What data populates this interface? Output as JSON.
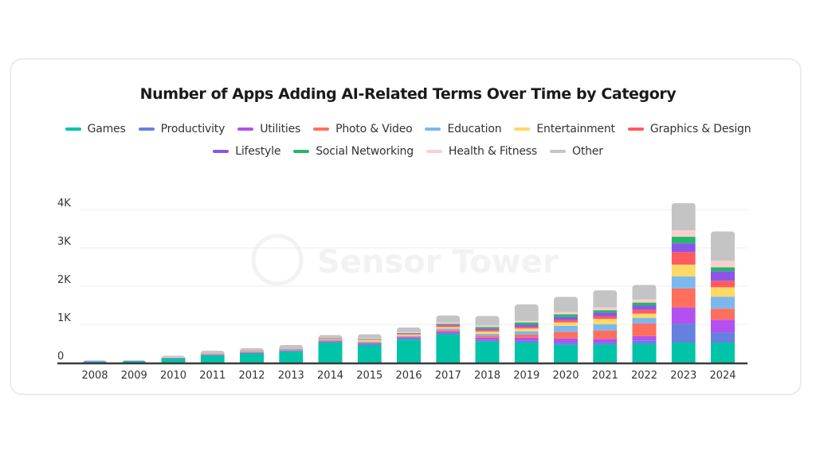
{
  "chart_data": {
    "type": "bar",
    "stacked": true,
    "title": "Number of Apps Adding AI-Related Terms Over Time by Category",
    "xlabel": "",
    "ylabel": "",
    "ylim": [
      0,
      4200
    ],
    "yticks": [
      0,
      1000,
      2000,
      3000,
      4000
    ],
    "ytick_labels": [
      "0",
      "1K",
      "2K",
      "3K",
      "4K"
    ],
    "grid": true,
    "legend_position": "top-center",
    "watermark": "Sensor Tower",
    "categories": [
      "2008",
      "2009",
      "2010",
      "2011",
      "2012",
      "2013",
      "2014",
      "2015",
      "2016",
      "2017",
      "2018",
      "2019",
      "2020",
      "2021",
      "2022",
      "2023",
      "2024"
    ],
    "series": [
      {
        "name": "Games",
        "color": "#00c4a7",
        "values": [
          20,
          40,
          110,
          190,
          240,
          290,
          520,
          460,
          600,
          740,
          550,
          520,
          460,
          470,
          480,
          520,
          520
        ]
      },
      {
        "name": "Productivity",
        "color": "#6680e0",
        "values": [
          10,
          5,
          5,
          10,
          10,
          15,
          20,
          20,
          25,
          30,
          40,
          50,
          60,
          50,
          100,
          500,
          270
        ]
      },
      {
        "name": "Utilities",
        "color": "#b450f0",
        "values": [
          5,
          5,
          5,
          10,
          10,
          15,
          20,
          20,
          30,
          40,
          60,
          80,
          110,
          100,
          110,
          420,
          330
        ]
      },
      {
        "name": "Photo & Video",
        "color": "#ff6f5c",
        "values": [
          0,
          0,
          5,
          10,
          10,
          10,
          20,
          20,
          20,
          40,
          50,
          80,
          170,
          220,
          330,
          500,
          290
        ]
      },
      {
        "name": "Education",
        "color": "#7cb8ee",
        "values": [
          20,
          5,
          5,
          10,
          10,
          10,
          20,
          30,
          30,
          40,
          50,
          90,
          160,
          160,
          150,
          310,
          310
        ]
      },
      {
        "name": "Entertainment",
        "color": "#ffd966",
        "values": [
          0,
          0,
          5,
          5,
          20,
          10,
          15,
          40,
          30,
          40,
          60,
          70,
          90,
          140,
          110,
          310,
          250
        ]
      },
      {
        "name": "Graphics & Design",
        "color": "#ff5a5f",
        "values": [
          0,
          0,
          0,
          5,
          5,
          5,
          10,
          10,
          15,
          40,
          40,
          40,
          60,
          70,
          100,
          330,
          170
        ]
      },
      {
        "name": "Lifestyle",
        "color": "#8a55e8",
        "values": [
          0,
          0,
          0,
          0,
          5,
          5,
          10,
          10,
          15,
          25,
          40,
          60,
          80,
          100,
          110,
          230,
          250
        ]
      },
      {
        "name": "Social Networking",
        "color": "#22b86a",
        "values": [
          0,
          0,
          0,
          0,
          0,
          5,
          5,
          10,
          10,
          20,
          40,
          60,
          70,
          60,
          80,
          170,
          100
        ]
      },
      {
        "name": "Health & Fitness",
        "color": "#fbd0cc",
        "values": [
          0,
          0,
          5,
          5,
          10,
          5,
          10,
          15,
          20,
          30,
          40,
          40,
          60,
          70,
          80,
          170,
          170
        ]
      },
      {
        "name": "Other",
        "color": "#c4c4c4",
        "values": [
          0,
          0,
          40,
          65,
          60,
          90,
          70,
          105,
          125,
          185,
          250,
          430,
          400,
          450,
          380,
          710,
          770
        ]
      }
    ]
  },
  "legend": {
    "row1": [
      "Games",
      "Productivity",
      "Utilities",
      "Photo & Video",
      "Education",
      "Entertainment",
      "Graphics & Design"
    ],
    "row2": [
      "Lifestyle",
      "Social Networking",
      "Health & Fitness",
      "Other"
    ]
  }
}
